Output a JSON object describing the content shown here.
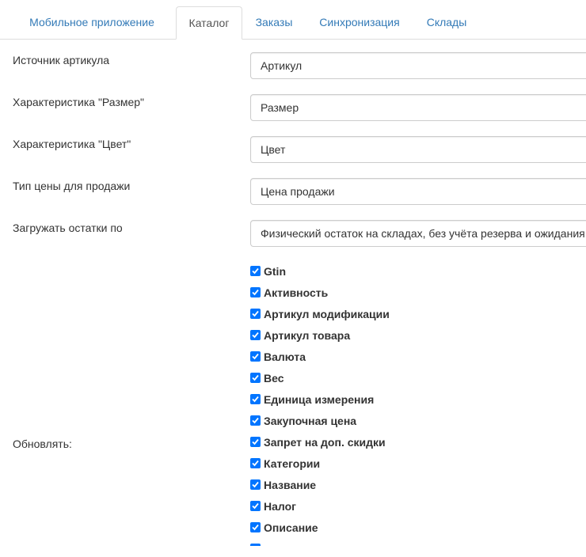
{
  "tabs": [
    {
      "label": "Мобильное приложение",
      "active": false
    },
    {
      "label": "Каталог",
      "active": true
    },
    {
      "label": "Заказы",
      "active": false
    },
    {
      "label": "Синхронизация",
      "active": false
    },
    {
      "label": "Склады",
      "active": false
    }
  ],
  "form": {
    "article_source": {
      "label": "Источник артикула",
      "value": "Артикул"
    },
    "size_characteristic": {
      "label": "Характеристика \"Размер\"",
      "value": "Размер"
    },
    "color_characteristic": {
      "label": "Характеристика \"Цвет\"",
      "value": "Цвет"
    },
    "sale_price_type": {
      "label": "Тип цены для продажи",
      "value": "Цена продажи"
    },
    "stock_load": {
      "label": "Загружать остатки по",
      "value": "Физический остаток на складах, без учёта резерва и ожидания"
    },
    "update": {
      "label": "Обновлять:",
      "items": [
        {
          "label": "Gtin",
          "checked": true
        },
        {
          "label": "Активность",
          "checked": true
        },
        {
          "label": "Артикул модификации",
          "checked": true
        },
        {
          "label": "Артикул товара",
          "checked": true
        },
        {
          "label": "Валюта",
          "checked": true
        },
        {
          "label": "Вес",
          "checked": true
        },
        {
          "label": "Единица измерения",
          "checked": true
        },
        {
          "label": "Закупочная цена",
          "checked": true
        },
        {
          "label": "Запрет на доп. скидки",
          "checked": true
        },
        {
          "label": "Категории",
          "checked": true
        },
        {
          "label": "Название",
          "checked": true
        },
        {
          "label": "Налог",
          "checked": true
        },
        {
          "label": "Описание",
          "checked": true
        }
      ]
    }
  },
  "colors": {
    "link": "#337ab7",
    "checkbox": "#0075ff",
    "border": "#dddddd"
  }
}
